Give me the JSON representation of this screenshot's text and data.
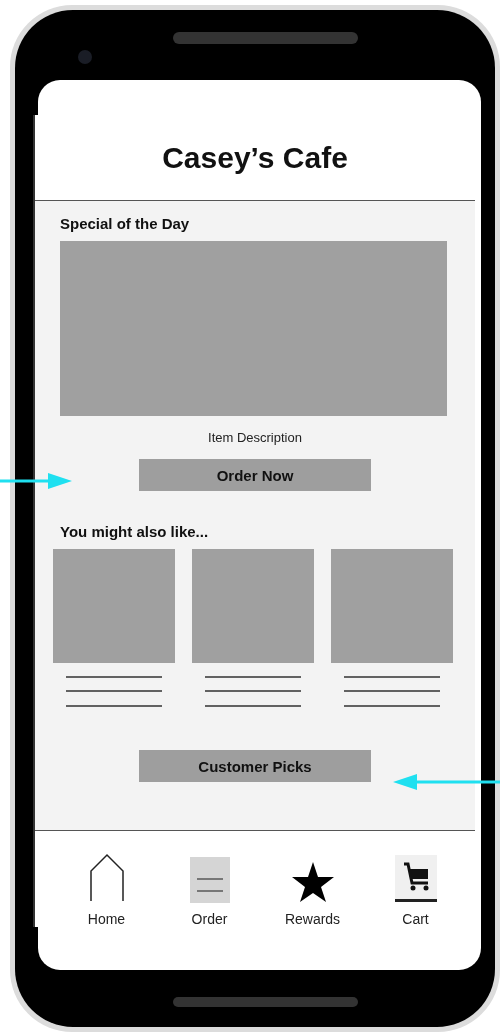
{
  "header": {
    "title": "Casey’s Cafe"
  },
  "special": {
    "heading": "Special of the Day",
    "image": {
      "kind": "placeholder"
    },
    "description": "Item Description",
    "button": "Order Now"
  },
  "suggestions": {
    "heading": "You might also like...",
    "items": [
      {
        "kind": "placeholder"
      },
      {
        "kind": "placeholder"
      },
      {
        "kind": "placeholder"
      }
    ],
    "button": "Customer Picks"
  },
  "nav": [
    {
      "kind": "home",
      "label": "Home"
    },
    {
      "kind": "order",
      "label": "Order"
    },
    {
      "kind": "rewards",
      "label": "Rewards"
    },
    {
      "kind": "cart",
      "label": "Cart"
    }
  ],
  "annotations": [
    {
      "kind": "arrow-right"
    },
    {
      "kind": "arrow-left"
    }
  ]
}
